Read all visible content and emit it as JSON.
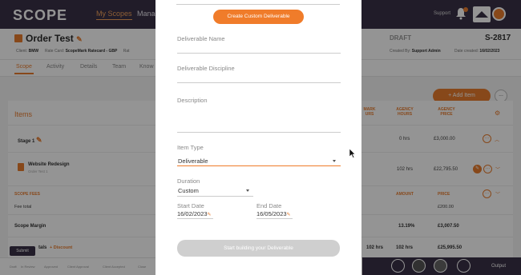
{
  "app": {
    "logo": "SCOPE",
    "nav": [
      "My Scopes",
      "Manag"
    ],
    "support_label": "Support"
  },
  "order": {
    "title": "Order Test",
    "client_label": "Client:",
    "client": "BMW",
    "rate_card_label": "Rate Card:",
    "rate_card": "ScopeMark Ratecard - GBP",
    "rate_card_tail": "Rat",
    "status": "DRAFT",
    "code": "S-2817",
    "created_by_label": "Created By:",
    "created_by": "Support Admin",
    "date_created_label": "Date created:",
    "date_created": "16/02/2023"
  },
  "tabs": [
    "Scope",
    "Activity",
    "Details",
    "Team",
    "Know"
  ],
  "items_section": {
    "title": "Items",
    "add_button": "+ Add Item",
    "more_button": "...",
    "col_mark_hours": "MARK\nURS",
    "col_agency_hours": "AGENCY\nHOURS",
    "col_agency_price": "AGENCY\nPRICE",
    "stage": {
      "name": "Stage 1",
      "hours": "0 hrs",
      "price": "£3,000.00"
    },
    "deliverable": {
      "name": "Website Redesign",
      "sub": "Order Test 1",
      "hours": "102 hrs",
      "price": "£22,795.50"
    },
    "scope_fees": {
      "label": "SCOPE FEES",
      "amount_label": "AMOUNT",
      "price_label": "PRICE"
    },
    "fee_total": {
      "label": "Fee total",
      "price": "£200.00"
    },
    "scope_margin": {
      "label": "Scope Margin",
      "percent": "13.19%",
      "price": "£3,007.50"
    },
    "totals": {
      "label": "tals",
      "discount": "+ Discount",
      "hours_a": "102 hrs",
      "hours_b": "102 hrs",
      "price": "£25,995.50"
    }
  },
  "status_bar": {
    "submit": "Submit",
    "steps": [
      "Draft",
      "In Review",
      "Approved",
      "Client Approval",
      "Client Accepted",
      "Close"
    ],
    "output": "Output"
  },
  "modal": {
    "create_button": "Create Custom Deliverable",
    "deliverable_name": {
      "label": "Deliverable Name",
      "value": ""
    },
    "deliverable_discipline": {
      "label": "Deliverable Discipline",
      "value": ""
    },
    "description": {
      "label": "Description",
      "value": ""
    },
    "item_type": {
      "label": "Item Type",
      "value": "Deliverable"
    },
    "duration": {
      "label": "Duration",
      "value": "Custom"
    },
    "start_date": {
      "label": "Start Date",
      "value": "16/02/2023"
    },
    "end_date": {
      "label": "End Date",
      "value": "16/05/2023"
    },
    "start_button": "Start building your Deliverable"
  },
  "colors": {
    "accent": "#f07c2a",
    "header_dark": "#3a3147",
    "disabled": "#cfcfcf"
  },
  "icons": [
    "pencil-icon",
    "bell-icon",
    "brand-logo-icon",
    "gear-icon",
    "chevron-down-icon",
    "caret-down-icon",
    "document-icon",
    "mouse-cursor-icon"
  ]
}
